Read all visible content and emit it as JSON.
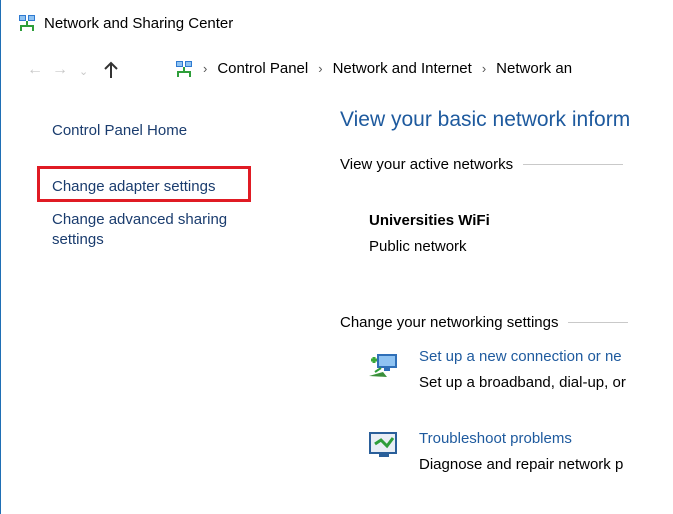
{
  "window": {
    "title": "Network and Sharing Center"
  },
  "icons": {
    "app": "network-sharing-icon",
    "address": "network-sharing-icon",
    "new_connection": "new-connection-icon",
    "troubleshoot": "troubleshoot-icon"
  },
  "navigation": {
    "back": "←",
    "forward": "→",
    "recent": "⌄",
    "up": "↑"
  },
  "breadcrumb": [
    "Control Panel",
    "Network and Internet",
    "Network an"
  ],
  "sidebar": {
    "home": "Control Panel Home",
    "adapter": "Change adapter settings",
    "advanced": "Change advanced sharing settings"
  },
  "main": {
    "heading": "View your basic network inform",
    "active_networks_label": "View your active networks",
    "network": {
      "name": "Universities WiFi",
      "type": "Public network"
    },
    "change_settings_label": "Change your networking settings",
    "tasks": [
      {
        "title": "Set up a new connection or ne",
        "description": "Set up a broadband, dial-up, or"
      },
      {
        "title": "Troubleshoot problems",
        "description": "Diagnose and repair network p"
      }
    ]
  },
  "colors": {
    "link": "#1e5a9e",
    "sidebar_link": "#1a3c6e",
    "highlight": "#e01b24",
    "window_border": "#1f6fb5"
  }
}
